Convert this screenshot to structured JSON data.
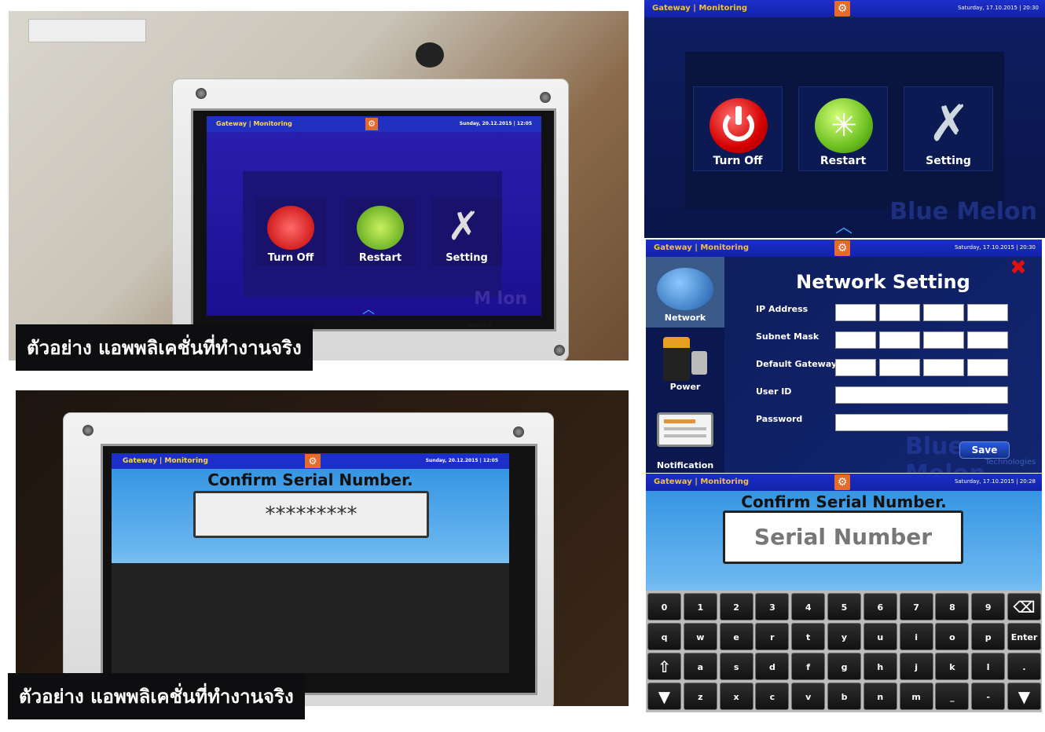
{
  "caption": "ตัวอย่าง แอพพลิเคชั่นที่ทำงานจริง",
  "header": {
    "title": "Gateway | Monitoring",
    "date_small": "Saturday, 17.10.2015 | 20:30",
    "date_serial": "Saturday, 17.10.2015 | 20:28",
    "photo_date_1": "Sunday, 20.12.2015 | 12:05",
    "photo_date_2": "Sunday, 20.12.2015 | 12:05"
  },
  "power_menu": {
    "turn_off": "Turn Off",
    "restart": "Restart",
    "setting": "Setting",
    "watermark": "Blue Melon",
    "watermark_photo": "M  lon"
  },
  "network": {
    "title": "Network Setting",
    "nav": [
      "Network",
      "Power",
      "Notification"
    ],
    "fields": [
      "IP Address",
      "Subnet Mask",
      "Default Gateway",
      "User ID",
      "Password"
    ],
    "save": "Save",
    "watermark": "Blue Melon",
    "watermark_sub": "Technologies"
  },
  "serial": {
    "title": "Confirm Serial Number.",
    "placeholder": "Serial Number",
    "masked": "*********",
    "enter": "Enter",
    "rows": [
      [
        "0",
        "1",
        "2",
        "3",
        "4",
        "5",
        "6",
        "7",
        "8",
        "9"
      ],
      [
        "q",
        "w",
        "e",
        "r",
        "t",
        "y",
        "u",
        "i",
        "o",
        "p"
      ],
      [
        "a",
        "s",
        "d",
        "f",
        "g",
        "h",
        "j",
        "k",
        "l",
        "."
      ],
      [
        "z",
        "x",
        "c",
        "v",
        "b",
        "n",
        "m",
        "_",
        "-"
      ]
    ]
  },
  "colors": {
    "header_blue": "#1c2fc9",
    "header_text": "#f0c040",
    "menu_bg": "#0a1750",
    "accent_orange": "#e86a2a"
  },
  "device": {
    "label": "AA1031-5"
  }
}
